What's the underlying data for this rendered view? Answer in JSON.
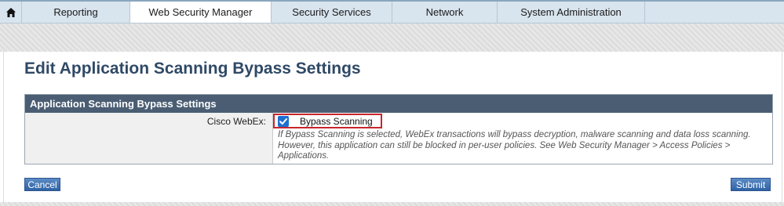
{
  "nav": {
    "home_icon": "home-icon",
    "tabs": [
      {
        "label": "Reporting",
        "active": false
      },
      {
        "label": "Web Security Manager",
        "active": true
      },
      {
        "label": "Security Services",
        "active": false
      },
      {
        "label": "Network",
        "active": false
      },
      {
        "label": "System Administration",
        "active": false
      }
    ]
  },
  "page": {
    "title": "Edit Application Scanning Bypass Settings"
  },
  "settings_table": {
    "header": "Application Scanning Bypass Settings",
    "rows": [
      {
        "label": "Cisco WebEx:",
        "checkbox_label": "Bypass Scanning",
        "checked": true,
        "help": "If Bypass Scanning is selected, WebEx transactions will bypass decryption, malware scanning and data loss scanning. However, this application can still be blocked in per-user policies. See Web Security Manager > Access Policies > Applications."
      }
    ]
  },
  "buttons": {
    "cancel": "Cancel",
    "submit": "Submit"
  },
  "colors": {
    "title": "#2f4966",
    "table_header": "#4a5d73",
    "button": "#2f63a6",
    "highlight_border": "#c8262c",
    "checkbox": "#1f6fd1"
  }
}
